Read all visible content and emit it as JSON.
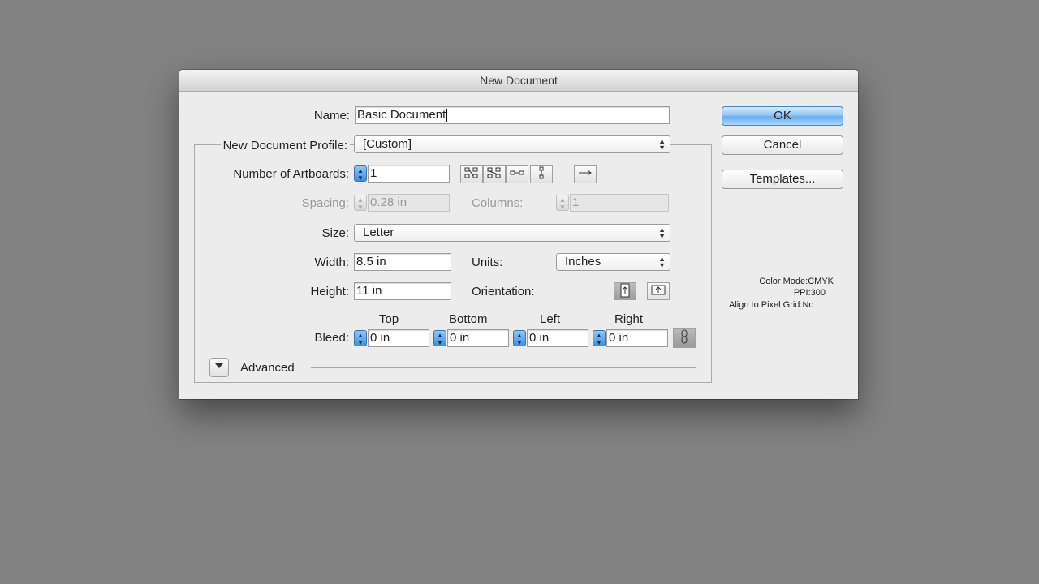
{
  "dialog": {
    "title": "New Document",
    "name_label": "Name:",
    "name_value": "Basic Document",
    "profile_label": "New Document Profile:",
    "profile_value": "[Custom]",
    "artboards_label": "Number of Artboards:",
    "artboards_value": "1",
    "spacing_label": "Spacing:",
    "spacing_value": "0.28 in",
    "columns_label": "Columns:",
    "columns_value": "1",
    "size_label": "Size:",
    "size_value": "Letter",
    "width_label": "Width:",
    "width_value": "8.5 in",
    "units_label": "Units:",
    "units_value": "Inches",
    "height_label": "Height:",
    "height_value": "11 in",
    "orientation_label": "Orientation:",
    "bleed_label": "Bleed:",
    "bleed_top_label": "Top",
    "bleed_bottom_label": "Bottom",
    "bleed_left_label": "Left",
    "bleed_right_label": "Right",
    "bleed_top": "0 in",
    "bleed_bottom": "0 in",
    "bleed_left": "0 in",
    "bleed_right": "0 in",
    "advanced_label": "Advanced"
  },
  "buttons": {
    "ok": "OK",
    "cancel": "Cancel",
    "templates": "Templates..."
  },
  "info": {
    "color_mode_label": "Color Mode:",
    "color_mode_value": "CMYK",
    "ppi_label": "PPI:",
    "ppi_value": "300",
    "align_label": "Align to Pixel Grid:",
    "align_value": "No"
  },
  "icons": {
    "arrange_grid_row": "grid-by-row-icon",
    "arrange_grid_col": "grid-by-column-icon",
    "arrange_row": "arrange-by-row-icon",
    "arrange_col": "arrange-by-column-icon",
    "layout_direction": "left-to-right-icon",
    "portrait": "portrait-icon",
    "landscape": "landscape-icon",
    "link_bleed": "chain-link-icon",
    "advanced_toggle": "disclosure-triangle-icon"
  },
  "colors": {
    "default_button": "#6aadf0",
    "background": "#828282"
  }
}
